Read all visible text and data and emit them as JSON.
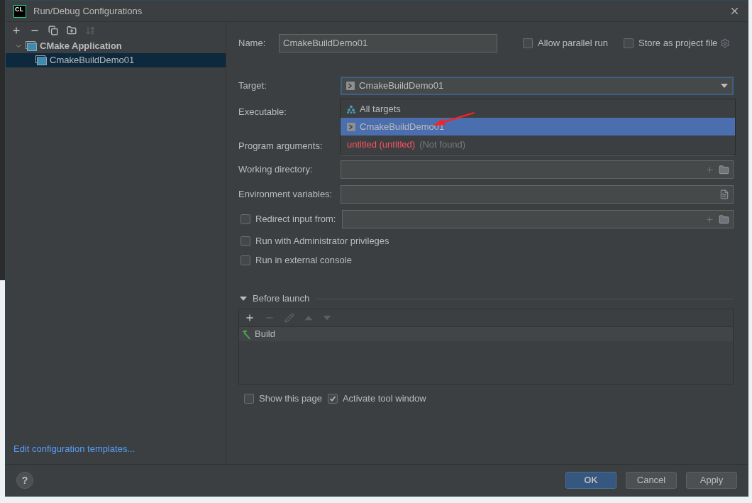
{
  "window": {
    "logo_text": "CL",
    "title": "Run/Debug Configurations"
  },
  "toolbar": [
    {
      "kind": "add",
      "disabled": false
    },
    {
      "kind": "remove",
      "disabled": false
    },
    {
      "kind": "copy",
      "disabled": false
    },
    {
      "kind": "folder",
      "disabled": false
    },
    {
      "kind": "sort",
      "disabled": true
    }
  ],
  "tree": [
    {
      "label": "CMake Application",
      "expanded": true,
      "selected": false,
      "children": [
        {
          "label": "CmakeBuildDemo01",
          "selected": true
        }
      ]
    }
  ],
  "templates_link": "Edit configuration templates...",
  "name": {
    "label": "Name:",
    "value": "CmakeBuildDemo01"
  },
  "header_options": [
    {
      "label": "Allow parallel run",
      "checked": false
    },
    {
      "label": "Store as project file",
      "checked": false
    }
  ],
  "target": {
    "label": "Target:",
    "value": "CmakeBuildDemo01",
    "expanded": true,
    "options": [
      {
        "label": "All targets",
        "kind": "all",
        "selected": false
      },
      {
        "label": "CmakeBuildDemo01",
        "kind": "target",
        "selected": true
      },
      {
        "label": "untitled (untitled)",
        "kind": "missing",
        "note": "(Not found)",
        "selected": false
      }
    ]
  },
  "executable": {
    "label": "Executable:"
  },
  "program_arguments": {
    "label": "Program arguments:"
  },
  "working_directory": {
    "label": "Working directory:"
  },
  "environment_variables": {
    "label": "Environment variables:"
  },
  "redirect": {
    "label": "Redirect input from:",
    "checked": false
  },
  "options": [
    {
      "label": "Run with Administrator privileges",
      "checked": false
    },
    {
      "label": "Run in external console",
      "checked": false
    }
  ],
  "before_launch": {
    "label": "Before launch",
    "expanded": true,
    "toolbar": [
      {
        "kind": "add",
        "disabled": false
      },
      {
        "kind": "remove",
        "disabled": true
      },
      {
        "kind": "edit",
        "disabled": true
      },
      {
        "kind": "up",
        "disabled": true
      },
      {
        "kind": "down",
        "disabled": true
      }
    ],
    "tasks": [
      {
        "label": "Build"
      }
    ]
  },
  "bottom_options": [
    {
      "label": "Show this page",
      "checked": false
    },
    {
      "label": "Activate tool window",
      "checked": true
    }
  ],
  "help": "?",
  "buttons": [
    {
      "label": "OK",
      "kind": "default"
    },
    {
      "label": "Cancel",
      "kind": "normal"
    },
    {
      "label": "Apply",
      "kind": "normal"
    }
  ]
}
